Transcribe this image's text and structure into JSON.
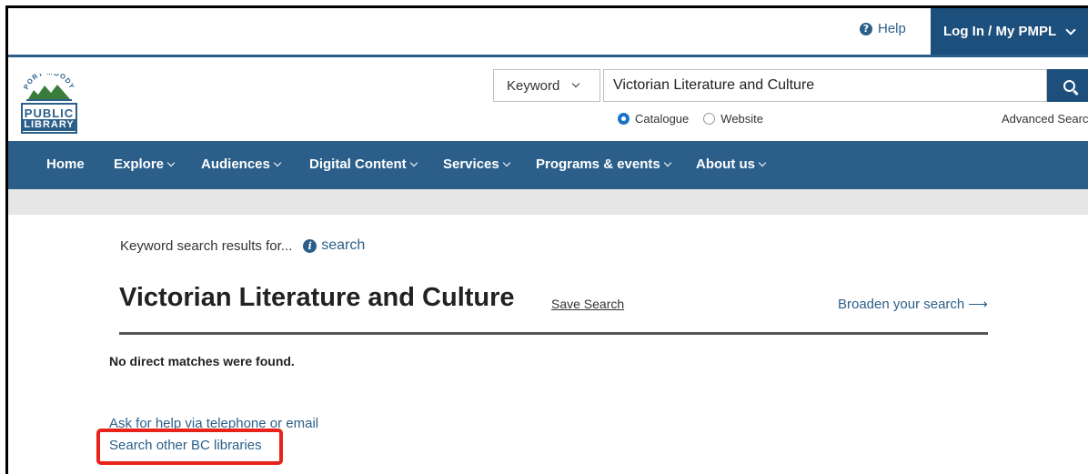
{
  "header": {
    "help_label": "Help",
    "login_label": "Log In / My PMPL"
  },
  "logo": {
    "arc_text": "PORT MOODY",
    "line1": "PUBLIC",
    "line2": "LIBRARY"
  },
  "search": {
    "type_selected": "Keyword",
    "query": "Victorian Literature and Culture",
    "scope_options": [
      {
        "label": "Catalogue",
        "selected": true
      },
      {
        "label": "Website",
        "selected": false
      }
    ],
    "advanced_label": "Advanced Search"
  },
  "nav": {
    "items": [
      {
        "label": "Home"
      },
      {
        "label": "Explore"
      },
      {
        "label": "Audiences"
      },
      {
        "label": "Digital Content"
      },
      {
        "label": "Services"
      },
      {
        "label": "Programs & events"
      },
      {
        "label": "About us"
      }
    ]
  },
  "results": {
    "intro": "Keyword search results for...",
    "info_link": "search",
    "title": "Victorian Literature and Culture",
    "save_search": "Save Search",
    "broaden": "Broaden your search",
    "no_matches": "No direct matches were found.",
    "help_link": "Ask for help via telephone or email",
    "bc_link": "Search other BC libraries"
  },
  "colors": {
    "brand": "#2b5f8a",
    "brand_dark": "#1d4f7c",
    "highlight": "#e8231a"
  }
}
